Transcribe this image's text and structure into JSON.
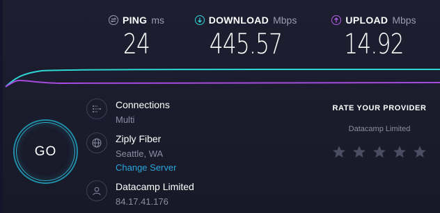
{
  "metrics": {
    "ping": {
      "label": "PING",
      "unit": "ms",
      "value": "24",
      "color": "#9a9cb3"
    },
    "download": {
      "label": "DOWNLOAD",
      "unit": "Mbps",
      "value": "445.57",
      "color": "#2fd6d6"
    },
    "upload": {
      "label": "UPLOAD",
      "unit": "Mbps",
      "value": "14.92",
      "color": "#b25ee8"
    }
  },
  "go_button": {
    "label": "GO"
  },
  "connections": {
    "title": "Connections",
    "value": "Multi",
    "icon": "connections-icon"
  },
  "server": {
    "title": "Ziply Fiber",
    "location": "Seattle, WA",
    "change_link": "Change Server",
    "icon": "globe-icon"
  },
  "provider": {
    "title": "Datacamp Limited",
    "ip": "84.17.41.176",
    "icon": "user-icon"
  },
  "rate": {
    "title": "RATE YOUR PROVIDER",
    "provider": "Datacamp Limited",
    "stars": 5,
    "rating": 0
  }
}
